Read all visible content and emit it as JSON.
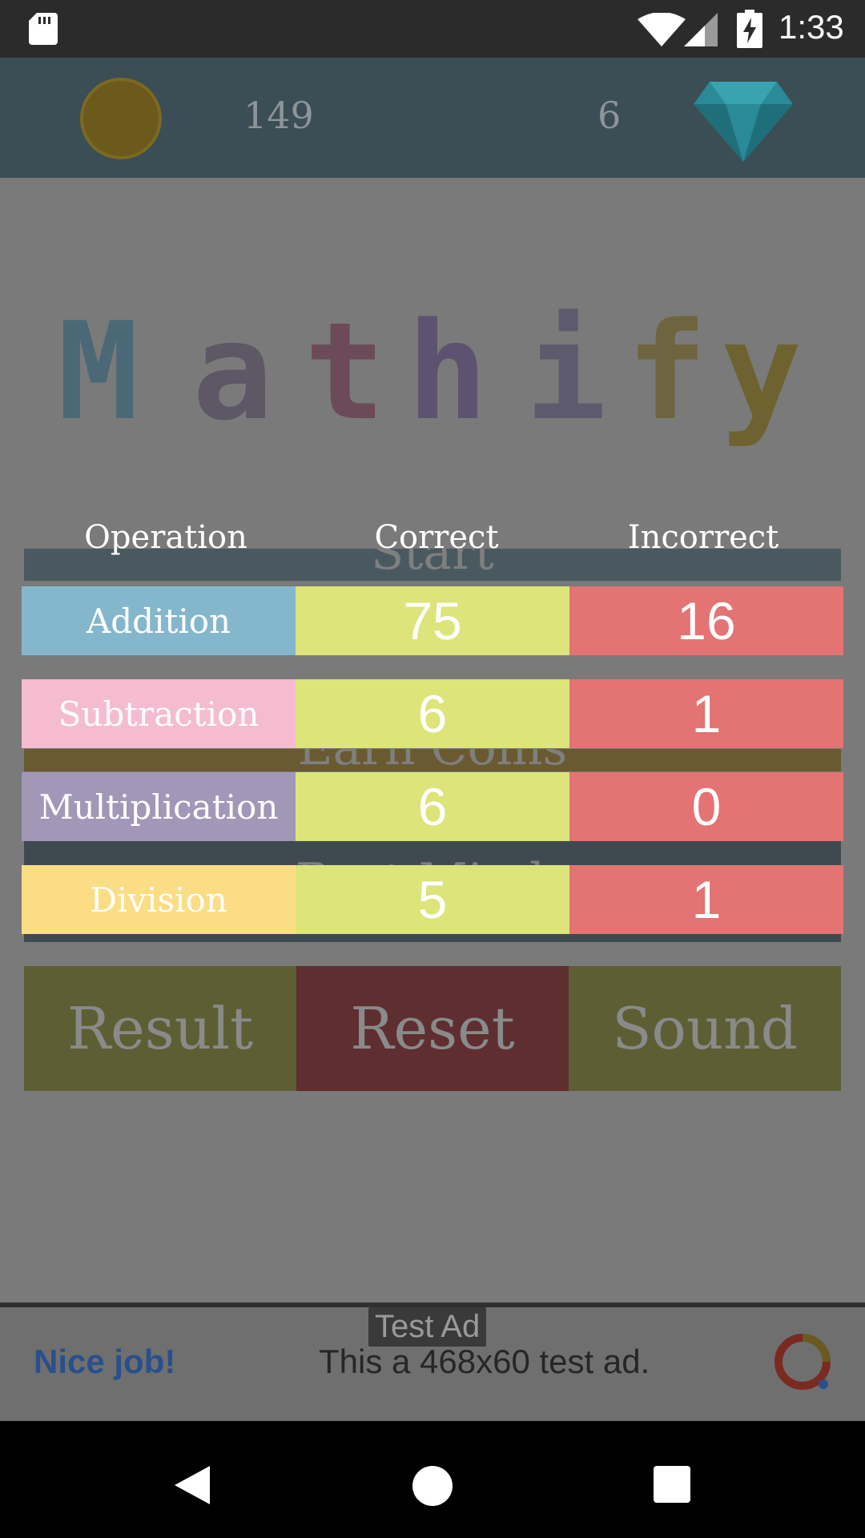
{
  "status_bar": {
    "time": "1:33"
  },
  "top_bar": {
    "coins": "149",
    "gems": "6"
  },
  "logo": {
    "letters": [
      {
        "char": "M",
        "color": "#4b6877"
      },
      {
        "char": "a",
        "color": "#5e5766"
      },
      {
        "char": "t",
        "color": "#6c4a58"
      },
      {
        "char": "h",
        "color": "#5d5370"
      },
      {
        "char": "i",
        "color": "#5e5a6d"
      },
      {
        "char": "f",
        "color": "#6e6540"
      },
      {
        "char": "y",
        "color": "#6e6230"
      }
    ]
  },
  "menu": {
    "start_label": "Start",
    "earn_label": "Earn Coins",
    "third_label": "Best Minds"
  },
  "table": {
    "headers": {
      "operation": "Operation",
      "correct": "Correct",
      "incorrect": "Incorrect"
    },
    "rows": [
      {
        "operation": "Addition",
        "correct": "75",
        "incorrect": "16",
        "color": "#84b7cc"
      },
      {
        "operation": "Subtraction",
        "correct": "6",
        "incorrect": "1",
        "color": "#f5bcd0"
      },
      {
        "operation": "Multiplication",
        "correct": "6",
        "incorrect": "0",
        "color": "#a397b8"
      },
      {
        "operation": "Division",
        "correct": "5",
        "incorrect": "1",
        "color": "#fbdd85"
      }
    ]
  },
  "buttons": {
    "result": "Result",
    "reset": "Reset",
    "sound": "Sound"
  },
  "ad": {
    "tag": "Test Ad",
    "headline": "Nice job!",
    "text": "This a 468x60 test ad."
  },
  "colors": {
    "correct": "#dce47a",
    "incorrect": "#e47373",
    "result_button": "#5e5e35",
    "reset_button": "#5f2e31",
    "sound_button": "#5e5e35"
  },
  "icons": [
    "sd-card-icon",
    "wifi-icon",
    "signal-icon",
    "battery-icon",
    "coin-icon",
    "diamond-icon",
    "ad-logo-icon",
    "back-icon",
    "home-icon",
    "recents-icon"
  ]
}
